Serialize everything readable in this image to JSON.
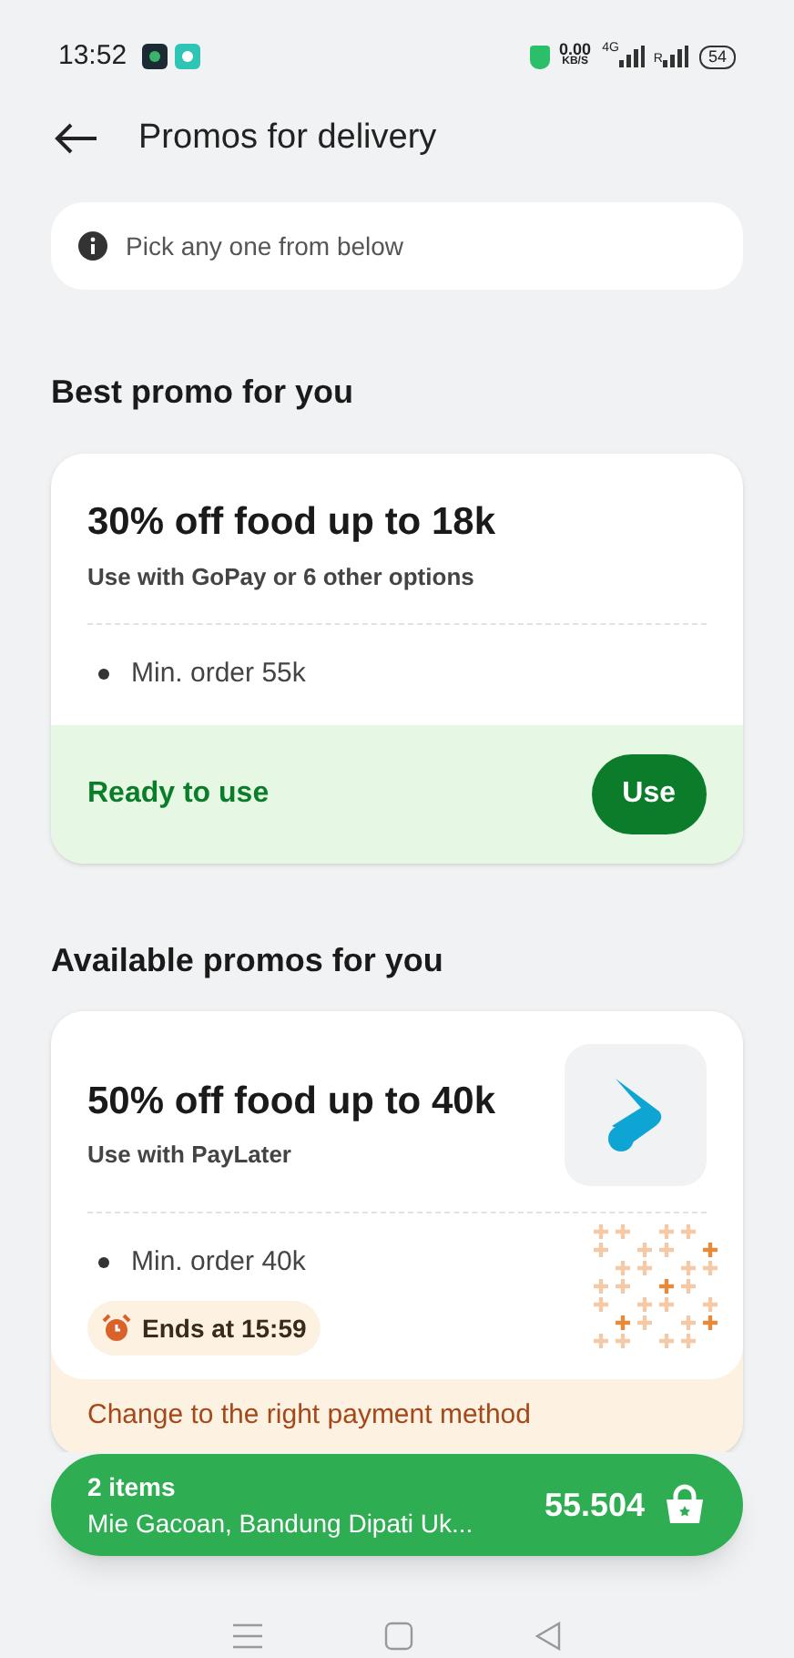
{
  "status_bar": {
    "time": "13:52",
    "speed": "0.00",
    "speed_unit": "KB/S",
    "network": "4G",
    "roaming": "R",
    "battery": "54"
  },
  "header": {
    "title": "Promos for delivery"
  },
  "info": {
    "text": "Pick any one from below"
  },
  "best": {
    "heading": "Best promo for you",
    "promo": {
      "title": "30% off food up to 18k",
      "subtitle": "Use with GoPay or 6 other options",
      "conditions": [
        "Min. order 55k"
      ],
      "status": "Ready to use",
      "button": "Use"
    }
  },
  "available": {
    "heading": "Available promos for you",
    "promos": [
      {
        "title": "50% off food up to 40k",
        "subtitle": "Use with PayLater",
        "conditions": [
          "Min. order 40k"
        ],
        "timer": "Ends at 15:59",
        "footer": "Change to the right payment method"
      }
    ]
  },
  "cart": {
    "items": "2 items",
    "restaurant": "Mie Gacoan, Bandung Dipati Uk...",
    "total": "55.504"
  }
}
